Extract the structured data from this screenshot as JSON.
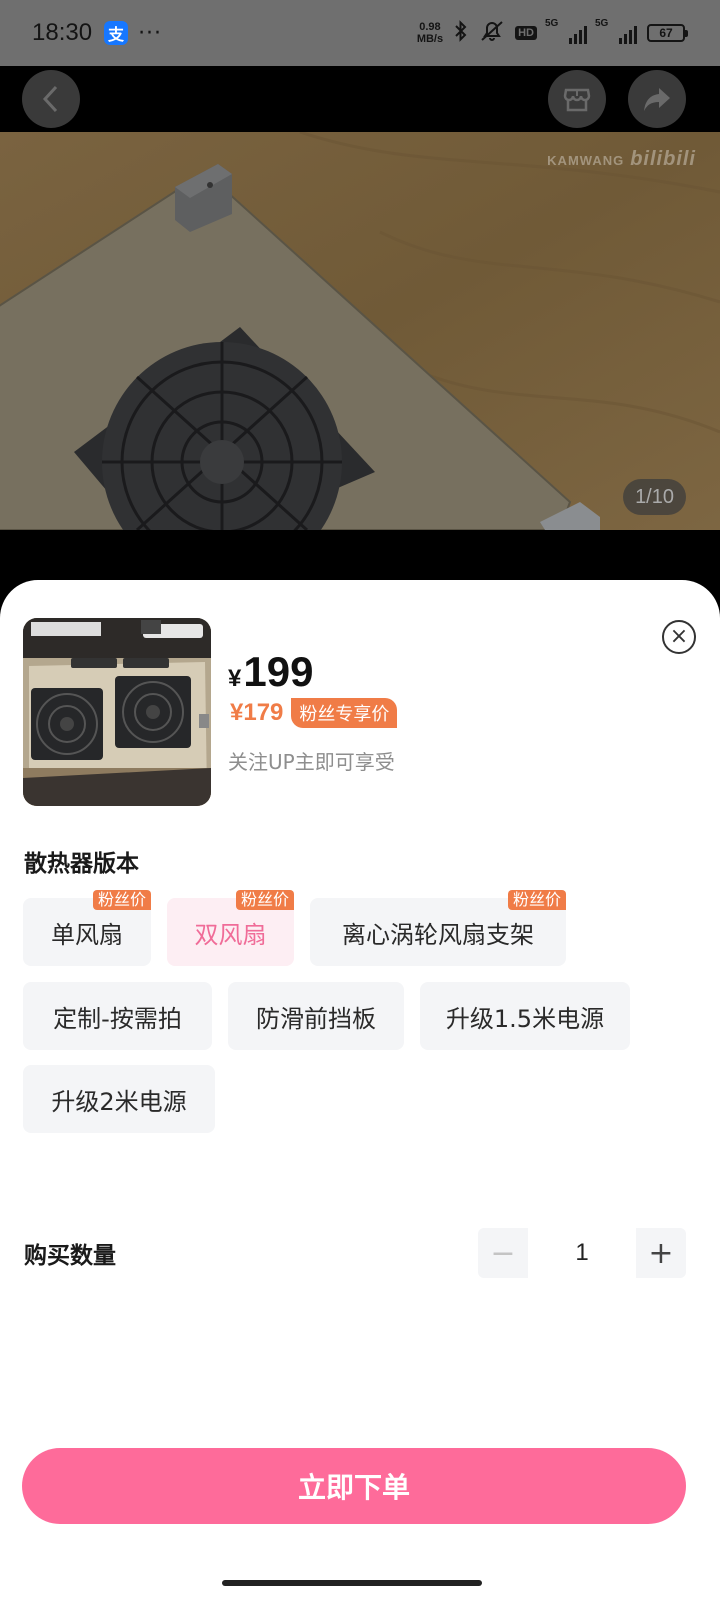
{
  "status_bar": {
    "time": "18:30",
    "alipay_glyph": "支",
    "more": "···",
    "net_speed_value": "0.98",
    "net_speed_unit": "MB/s",
    "hd_label": "HD",
    "signal1_label": "5G",
    "signal2_label": "5G",
    "battery": "67"
  },
  "gallery": {
    "watermark_text": "KAMWANG",
    "watermark_logo": "bilibili",
    "counter": "1/10"
  },
  "product": {
    "currency": "¥",
    "price": "199",
    "fan_price": "¥179",
    "fan_badge": "粉丝专享价",
    "follow_tip": "关注UP主即可享受"
  },
  "variants": {
    "title": "散热器版本",
    "options": [
      {
        "label": "单风扇",
        "badge": "粉丝价",
        "selected": false
      },
      {
        "label": "双风扇",
        "badge": "粉丝价",
        "selected": true
      },
      {
        "label": "离心涡轮风扇支架",
        "badge": "粉丝价",
        "selected": false
      },
      {
        "label": "定制-按需拍",
        "badge": "",
        "selected": false
      },
      {
        "label": "防滑前挡板",
        "badge": "",
        "selected": false
      },
      {
        "label": "升级1.5米电源",
        "badge": "",
        "selected": false
      },
      {
        "label": "升级2米电源",
        "badge": "",
        "selected": false
      }
    ]
  },
  "quantity": {
    "label": "购买数量",
    "value": "1",
    "minus": "−",
    "plus": "+"
  },
  "actions": {
    "order_label": "立即下单",
    "close_glyph": "×"
  },
  "colors": {
    "accent_pink": "#fe6b9a",
    "fan_orange": "#f07c47",
    "selected_bg": "#fdeef3",
    "selected_text": "#f06c98"
  }
}
